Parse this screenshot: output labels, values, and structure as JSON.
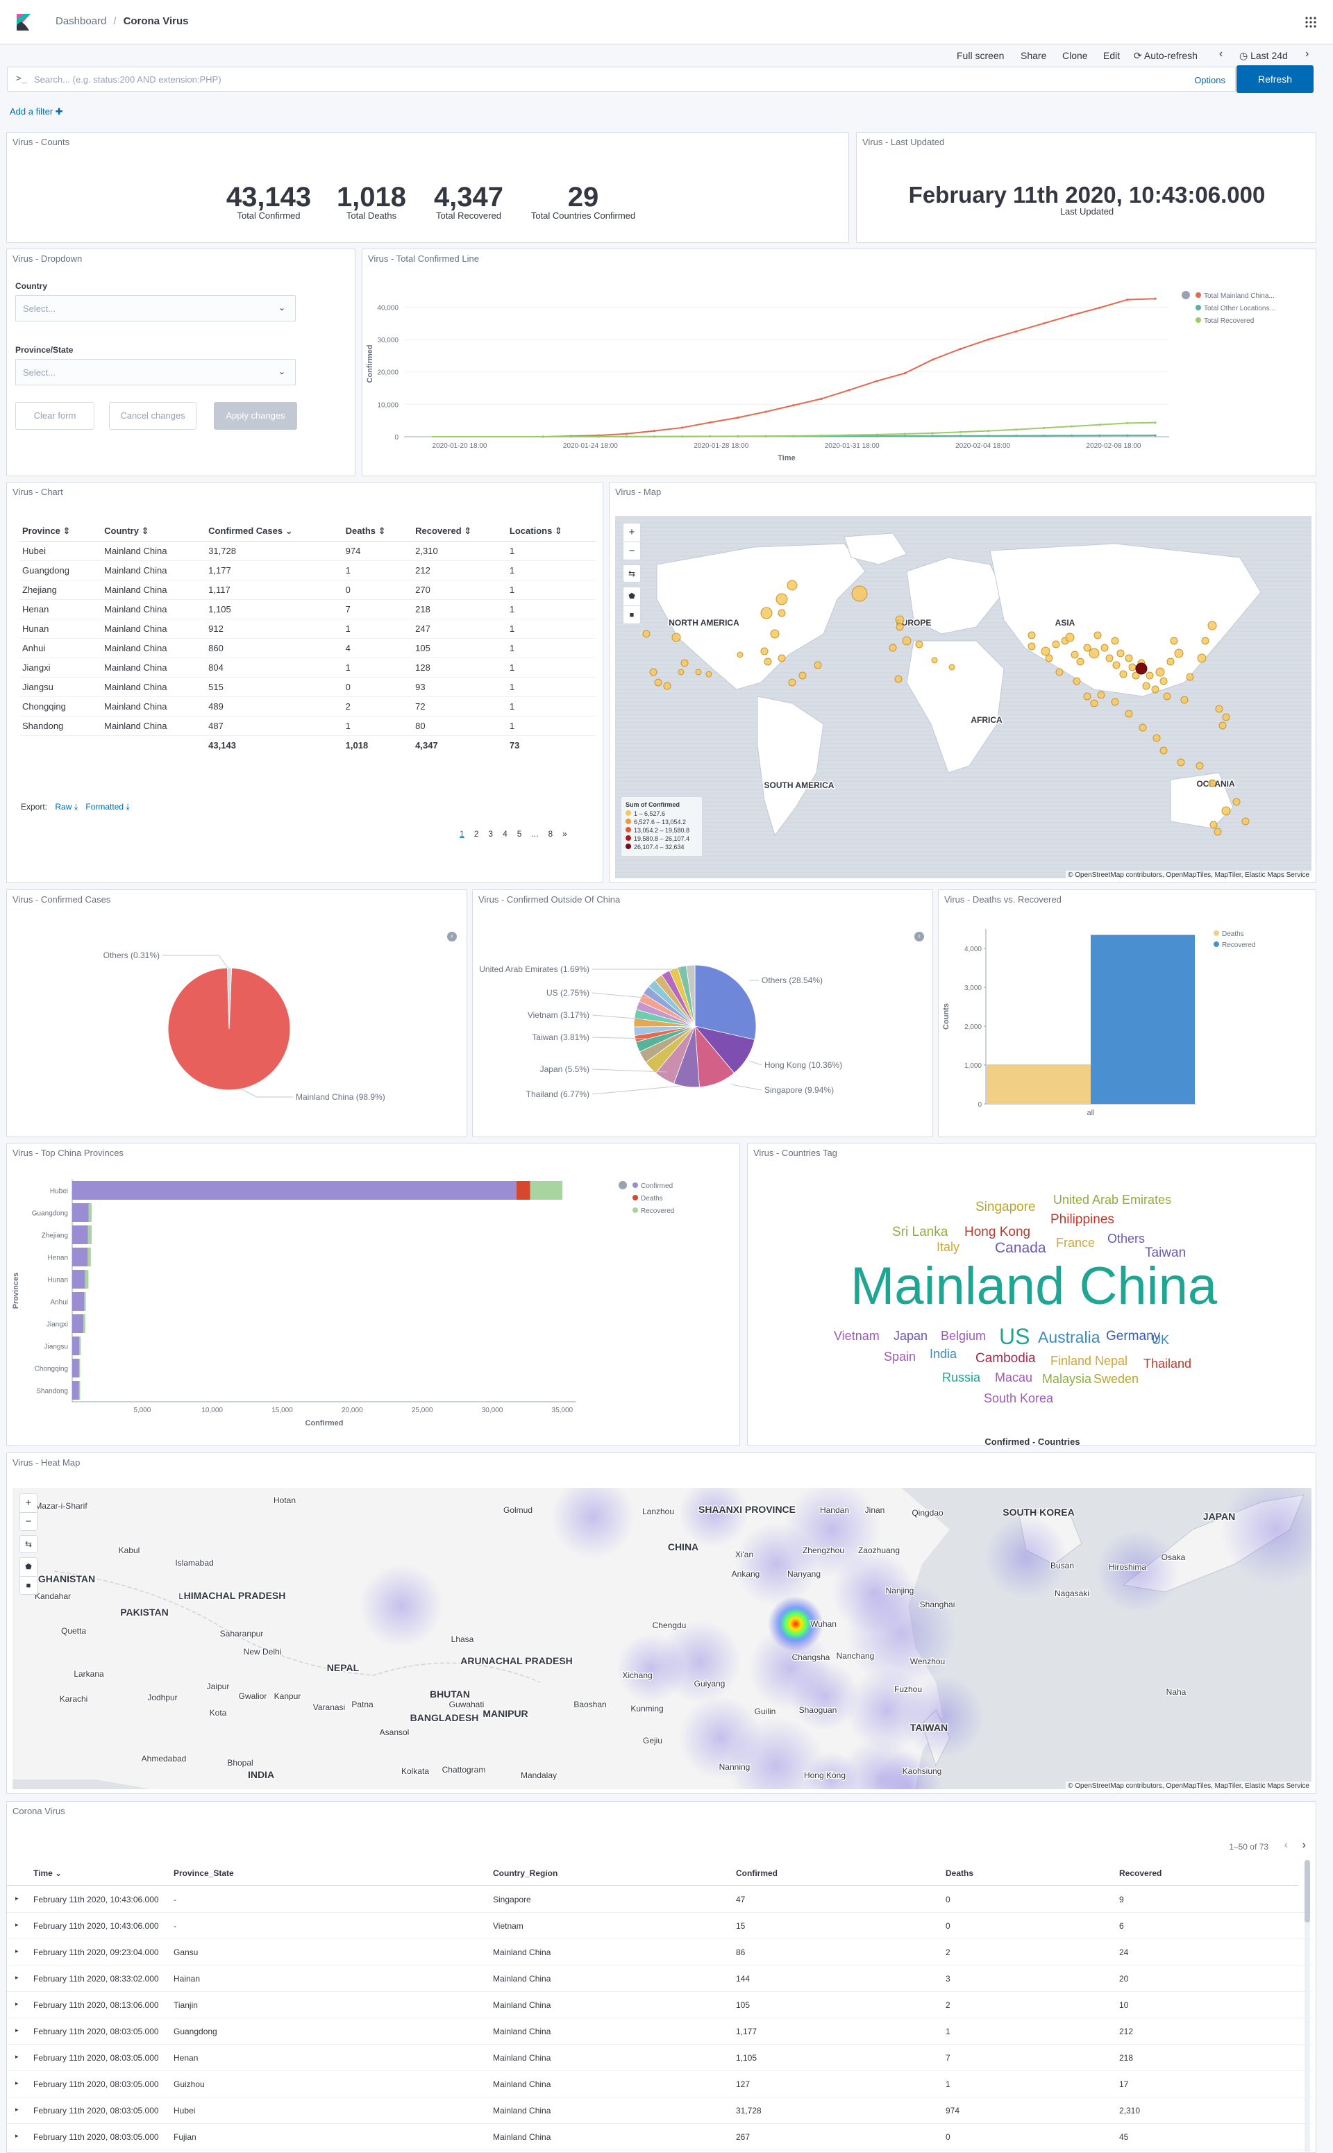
{
  "header": {
    "breadcrumb_root": "Dashboard",
    "breadcrumb_current": "Corona Virus"
  },
  "menu": {
    "fullscreen": "Full screen",
    "share": "Share",
    "clone": "Clone",
    "edit": "Edit",
    "autorefresh": "Auto-refresh",
    "timerange": "Last 24d"
  },
  "query": {
    "prompt": ">_",
    "placeholder": "Search... (e.g. status:200 AND extension:PHP)",
    "options": "Options",
    "refresh": "Refresh"
  },
  "add_filter": "Add a filter",
  "counts": {
    "title": "Virus - Counts",
    "items": [
      {
        "value": "43,143",
        "label": "Total Confirmed"
      },
      {
        "value": "1,018",
        "label": "Total Deaths"
      },
      {
        "value": "4,347",
        "label": "Total Recovered"
      },
      {
        "value": "29",
        "label": "Total Countries Confirmed"
      }
    ]
  },
  "last_updated": {
    "title": "Virus - Last Updated",
    "value": "February 11th 2020, 10:43:06.000",
    "label": "Last Updated"
  },
  "dropdown": {
    "title": "Virus - Dropdown",
    "country_label": "Country",
    "country_placeholder": "Select...",
    "province_label": "Province/State",
    "province_placeholder": "Select...",
    "clear": "Clear form",
    "cancel": "Cancel changes",
    "apply": "Apply changes"
  },
  "line_chart": {
    "title": "Virus - Total Confirmed Line"
  },
  "table_panel": {
    "title": "Virus - Chart",
    "headers": [
      "Province",
      "Country",
      "Confirmed Cases",
      "Deaths",
      "Recovered",
      "Locations"
    ],
    "rows": [
      [
        "Hubei",
        "Mainland China",
        "31,728",
        "974",
        "2,310",
        "1"
      ],
      [
        "Guangdong",
        "Mainland China",
        "1,177",
        "1",
        "212",
        "1"
      ],
      [
        "Zhejiang",
        "Mainland China",
        "1,117",
        "0",
        "270",
        "1"
      ],
      [
        "Henan",
        "Mainland China",
        "1,105",
        "7",
        "218",
        "1"
      ],
      [
        "Hunan",
        "Mainland China",
        "912",
        "1",
        "247",
        "1"
      ],
      [
        "Anhui",
        "Mainland China",
        "860",
        "4",
        "105",
        "1"
      ],
      [
        "Jiangxi",
        "Mainland China",
        "804",
        "1",
        "128",
        "1"
      ],
      [
        "Jiangsu",
        "Mainland China",
        "515",
        "0",
        "93",
        "1"
      ],
      [
        "Chongqing",
        "Mainland China",
        "489",
        "2",
        "72",
        "1"
      ],
      [
        "Shandong",
        "Mainland China",
        "487",
        "1",
        "80",
        "1"
      ]
    ],
    "totals": [
      "",
      "",
      "43,143",
      "1,018",
      "4,347",
      "73"
    ],
    "export": "Export:",
    "raw": "Raw",
    "formatted": "Formatted",
    "pages": [
      "1",
      "2",
      "3",
      "4",
      "5",
      "...",
      "8",
      "»"
    ]
  },
  "map": {
    "title": "Virus - Map",
    "labels": [
      "NORTH AMERICA",
      "EUROPE",
      "ASIA",
      "AFRICA",
      "SOUTH AMERICA",
      "OCEANIA"
    ],
    "legend_title": "Sum of Confirmed",
    "legend": [
      {
        "label": "1 – 6,527.6",
        "color": "#f6c85f"
      },
      {
        "label": "6,527.6 – 13,054.2",
        "color": "#f09a3e"
      },
      {
        "label": "13,054.2 – 19,580.8",
        "color": "#e4572e"
      },
      {
        "label": "19,580.8 – 26,107.4",
        "color": "#b5171c"
      },
      {
        "label": "26,107.4 – 32,634",
        "color": "#7c0a12"
      }
    ],
    "attribution": "© OpenStreetMap contributors, OpenMapTiles, MapTiler, Elastic Maps Service"
  },
  "pie1": {
    "title": "Virus - Confirmed Cases"
  },
  "pie2": {
    "title": "Virus - Confirmed Outside Of China"
  },
  "bars1": {
    "title": "Virus - Deaths vs. Recovered"
  },
  "hbar": {
    "title": "Virus - Top China Provinces"
  },
  "tagcloud": {
    "title": "Virus - Countries Tag",
    "caption": "Confirmed - Countries",
    "words": [
      {
        "text": "Singapore",
        "color": "#b9a52b"
      },
      {
        "text": "United Arab Emirates",
        "color": "#8fae3f"
      },
      {
        "text": "Philippines",
        "color": "#c0392b"
      },
      {
        "text": "Sri Lanka",
        "color": "#8fae3f"
      },
      {
        "text": "Hong Kong",
        "color": "#c0392b"
      },
      {
        "text": "Italy",
        "color": "#d1a63a"
      },
      {
        "text": "Canada",
        "color": "#6b57b4"
      },
      {
        "text": "France",
        "color": "#d1a63a"
      },
      {
        "text": "Others",
        "color": "#6b57b4"
      },
      {
        "text": "Taiwan",
        "color": "#6b57b4"
      },
      {
        "text": "Mainland China",
        "color": "#1ea593"
      },
      {
        "text": "Vietnam",
        "color": "#a05ab9"
      },
      {
        "text": "Japan",
        "color": "#6b57b4"
      },
      {
        "text": "Belgium",
        "color": "#a05ab9"
      },
      {
        "text": "US",
        "color": "#1ea593"
      },
      {
        "text": "Australia",
        "color": "#3b8bc2"
      },
      {
        "text": "Germany",
        "color": "#3b5bb4"
      },
      {
        "text": "UK",
        "color": "#3b8bc2"
      },
      {
        "text": "Spain",
        "color": "#a05ab9"
      },
      {
        "text": "India",
        "color": "#3b8bc2"
      },
      {
        "text": "Cambodia",
        "color": "#a02b4b"
      },
      {
        "text": "Finland",
        "color": "#d1a63a"
      },
      {
        "text": "Nepal",
        "color": "#d1a63a"
      },
      {
        "text": "Thailand",
        "color": "#c0392b"
      },
      {
        "text": "Russia",
        "color": "#1ea593"
      },
      {
        "text": "Macau",
        "color": "#a05ab9"
      },
      {
        "text": "Malaysia",
        "color": "#8fae3f"
      },
      {
        "text": "Sweden",
        "color": "#b9a52b"
      },
      {
        "text": "South Korea",
        "color": "#a05ab9"
      }
    ]
  },
  "heatmap": {
    "title": "Virus - Heat Map",
    "labels": [
      "Mazar-i-Sharif",
      "Hotan",
      "Golmud",
      "Lanzhou",
      "SHAANXI PROVINCE",
      "Handan",
      "Jinan",
      "Qingdao",
      "SOUTH KOREA",
      "JAPAN",
      "Kabul",
      "Islamabad",
      "CHINA",
      "Xi'an",
      "Zhengzhou",
      "Zaozhuang",
      "Busan",
      "Hiroshima",
      "Osaka",
      "GHANISTAN",
      "Lahore",
      "Ankang",
      "Nanyang",
      "Nanjing",
      "Nagasaki",
      "Kandahar",
      "HIMACHAL PRADESH",
      "Shanghai",
      "PAKISTAN",
      "Quetta",
      "Saharanpur",
      "Lhasa",
      "Chengdu",
      "Wuhan",
      "New Delhi",
      "NEPAL",
      "ARUNACHAL PRADESH",
      "Changsha",
      "Nanchang",
      "Wenzhou",
      "Larkana",
      "Jaipur",
      "Gwalior",
      "Kanpur",
      "BHUTAN",
      "Guwahati",
      "Xichang",
      "Guiyang",
      "Fuzhou",
      "Karachi",
      "Jodhpur",
      "Varanasi",
      "Patna",
      "Baoshan",
      "Kunming",
      "Guilin",
      "Shaoguan",
      "Naha",
      "Kota",
      "BANGLADESH",
      "MANIPUR",
      "Asansol",
      "Gejiu",
      "TAIWAN",
      "Ahmedabad",
      "Bhopal",
      "INDIA",
      "Kolkata",
      "Chattogram",
      "Mandalay",
      "Nanning",
      "Hong Kong",
      "Kaohsiung"
    ],
    "attribution": "© OpenStreetMap contributors, OpenMapTiles, MapTiler, Elastic Maps Service"
  },
  "datatable": {
    "title": "Corona Virus",
    "pagination": "1–50 of 73",
    "headers": [
      "Time",
      "Province_State",
      "Country_Region",
      "Confirmed",
      "Deaths",
      "Recovered"
    ],
    "rows": [
      [
        "February 11th 2020, 10:43:06.000",
        "-",
        "Singapore",
        "47",
        "0",
        "9"
      ],
      [
        "February 11th 2020, 10:43:06.000",
        "-",
        "Vietnam",
        "15",
        "0",
        "6"
      ],
      [
        "February 11th 2020, 09:23:04.000",
        "Gansu",
        "Mainland China",
        "86",
        "2",
        "24"
      ],
      [
        "February 11th 2020, 08:33:02.000",
        "Hainan",
        "Mainland China",
        "144",
        "3",
        "20"
      ],
      [
        "February 11th 2020, 08:13:06.000",
        "Tianjin",
        "Mainland China",
        "105",
        "2",
        "10"
      ],
      [
        "February 11th 2020, 08:03:05.000",
        "Guangdong",
        "Mainland China",
        "1,177",
        "1",
        "212"
      ],
      [
        "February 11th 2020, 08:03:05.000",
        "Henan",
        "Mainland China",
        "1,105",
        "7",
        "218"
      ],
      [
        "February 11th 2020, 08:03:05.000",
        "Guizhou",
        "Mainland China",
        "127",
        "1",
        "17"
      ],
      [
        "February 11th 2020, 08:03:05.000",
        "Hubei",
        "Mainland China",
        "31,728",
        "974",
        "2,310"
      ],
      [
        "February 11th 2020, 08:03:05.000",
        "Fujian",
        "Mainland China",
        "267",
        "0",
        "45"
      ]
    ]
  },
  "chart_data": [
    {
      "type": "line",
      "x": [
        "2020-01-20 18:00",
        "2020-01-24 18:00",
        "2020-01-28 18:00",
        "2020-01-31 18:00",
        "2020-02-04 18:00",
        "2020-02-08 18:00"
      ],
      "xlabel": "Time",
      "ylabel": "Confirmed",
      "ylim": [
        0,
        45000
      ],
      "yticks": [
        "0",
        "10,000",
        "20,000",
        "30,000",
        "40,000"
      ],
      "legend_position": "top-right",
      "series": [
        {
          "name": "Total Mainland China...",
          "color": "#e7664c",
          "values": [
            0,
            0,
            0,
            0,
            0,
            200,
            400,
            900,
            1800,
            2800,
            4400,
            5900,
            7700,
            9700,
            11700,
            14400,
            17200,
            19600,
            23800,
            27100,
            30000,
            32500,
            35000,
            37500,
            39800,
            42300,
            42600
          ]
        },
        {
          "name": "Total Other Locations...",
          "color": "#54b399",
          "values": [
            0,
            0,
            0,
            0,
            0,
            10,
            20,
            30,
            40,
            60,
            80,
            100,
            120,
            140,
            160,
            180,
            200,
            220,
            240,
            260,
            280,
            300,
            320,
            350,
            380,
            400,
            420
          ]
        },
        {
          "name": "Total Recovered",
          "color": "#9ccc65",
          "values": [
            0,
            0,
            0,
            0,
            0,
            0,
            0,
            30,
            50,
            60,
            100,
            130,
            200,
            250,
            350,
            500,
            650,
            850,
            1100,
            1450,
            1800,
            2200,
            2700,
            3200,
            3700,
            4200,
            4350
          ]
        }
      ]
    },
    {
      "type": "pie",
      "categories": [
        "Mainland China (98.9%)",
        "Others (0.31%)"
      ],
      "values": [
        98.9,
        1.1
      ],
      "colors": [
        "#e7605c",
        "#cfd6dd"
      ]
    },
    {
      "type": "pie",
      "categories": [
        "Others (28.54%)",
        "Hong Kong (10.36%)",
        "Singapore (9.94%)",
        "Thailand (6.77%)",
        "Japan (5.5%)",
        "Taiwan (3.81%)",
        "Vietnam (3.17%)",
        "US (2.75%)",
        "United Arab Emirates (1.69%)"
      ],
      "values": [
        28.54,
        10.36,
        9.94,
        6.77,
        5.5,
        3.81,
        3.17,
        2.75,
        1.69
      ],
      "colors": [
        "#6f87d8",
        "#7e4fb0",
        "#d36086",
        "#9170b8",
        "#ca8eae",
        "#d6bf57",
        "#b9a888",
        "#54b399",
        "#e7664c"
      ]
    },
    {
      "type": "bar",
      "categories": [
        "all"
      ],
      "ylabel": "Counts",
      "ylim": [
        0,
        4500
      ],
      "yticks": [
        "0",
        "1,000",
        "2,000",
        "3,000",
        "4,000"
      ],
      "series": [
        {
          "name": "Deaths",
          "color": "#f1d086",
          "values": [
            1018
          ]
        },
        {
          "name": "Recovered",
          "color": "#4a90d0",
          "values": [
            4347
          ]
        }
      ]
    },
    {
      "type": "bar",
      "orientation": "horizontal",
      "categories": [
        "Hubei",
        "Guangdong",
        "Zhejiang",
        "Henan",
        "Hunan",
        "Anhui",
        "Jiangxi",
        "Jiangsu",
        "Chongqing",
        "Shandong"
      ],
      "xlabel": "Confirmed",
      "ylabel": "Provinces",
      "xlim": [
        0,
        36000
      ],
      "xticks": [
        "5,000",
        "10,000",
        "15,000",
        "20,000",
        "25,000",
        "30,000",
        "35,000"
      ],
      "series": [
        {
          "name": "Confirmed",
          "color": "#9b8dd3",
          "values": [
            31728,
            1177,
            1117,
            1105,
            912,
            860,
            804,
            515,
            489,
            487
          ]
        },
        {
          "name": "Deaths",
          "color": "#d6472e",
          "values": [
            974,
            1,
            0,
            7,
            1,
            4,
            1,
            0,
            2,
            1
          ]
        },
        {
          "name": "Recovered",
          "color": "#a8d4a0",
          "values": [
            2310,
            212,
            270,
            218,
            247,
            105,
            128,
            93,
            72,
            80
          ]
        }
      ]
    }
  ]
}
